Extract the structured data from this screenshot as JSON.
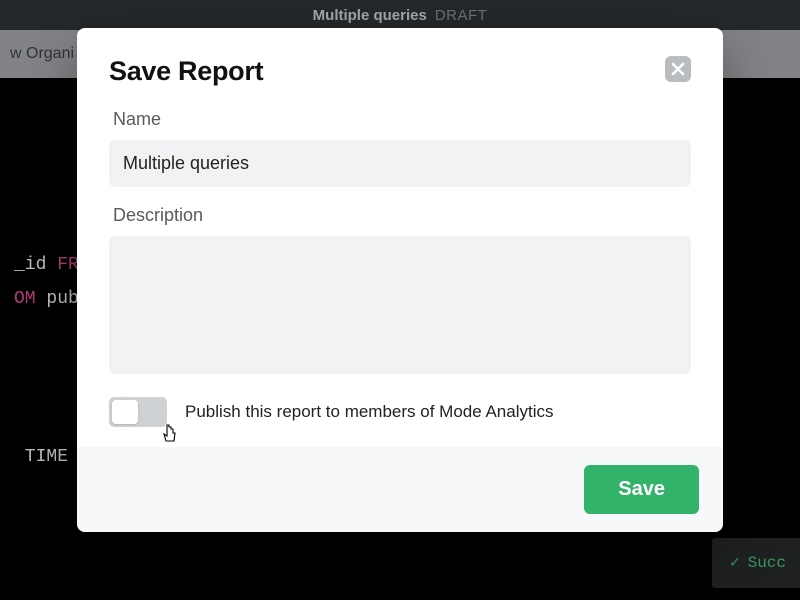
{
  "app": {
    "report_title": "Multiple queries",
    "draft_badge": "DRAFT",
    "toolbar_left_fragment": "w Organi"
  },
  "editor": {
    "line1_a": "_id ",
    "line1_kw": "FRO",
    "line2_kw": "OM",
    "line2_rest": " publ",
    "line5": " TIME ZO"
  },
  "status": {
    "label_fragment": "Succ"
  },
  "modal": {
    "title": "Save Report",
    "name_label": "Name",
    "name_value": "Multiple queries",
    "description_label": "Description",
    "description_value": "",
    "publish_label": "Publish this report to members of Mode Analytics",
    "publish_on": false,
    "save_label": "Save"
  },
  "colors": {
    "accent_green": "#33b36a",
    "keyword_pink": "#d3448b"
  }
}
